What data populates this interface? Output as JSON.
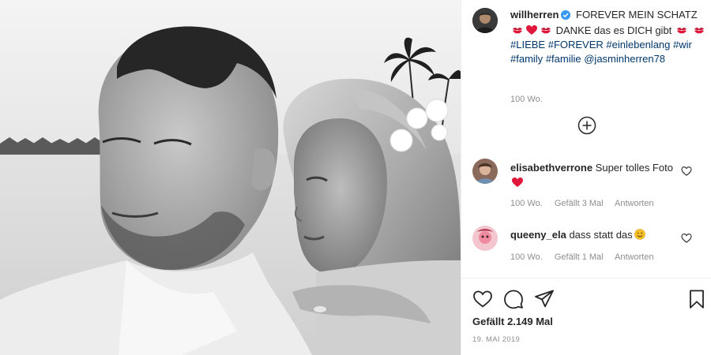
{
  "post": {
    "author": "willherren",
    "caption_parts": {
      "t1": "FOREVER MEIN SCHATZ",
      "t2": "DANKE das es DICH gibt",
      "tag_liebe": "#LIEBE",
      "tag_forever": "#FOREVER",
      "tag_einlebenlang": "#einlebenlang",
      "tag_wir": "#wir",
      "tag_family": "#family",
      "tag_familie": "#familie",
      "mention": "@jasminherren78"
    },
    "time": "100 Wo."
  },
  "comments": [
    {
      "user": "elisabethverrone",
      "text": "Super tolles Foto",
      "time": "100 Wo.",
      "likes": "Gefällt 3 Mal",
      "reply": "Antworten"
    },
    {
      "user": "queeny_ela",
      "text": "dass statt das",
      "time": "100 Wo.",
      "likes": "Gefällt 1 Mal",
      "reply": "Antworten"
    }
  ],
  "footer": {
    "likes": "Gefällt 2.149 Mal",
    "date": "19. MAI 2019"
  },
  "icons": {
    "verified": "verified-badge-icon",
    "load_more": "plus-circle-icon",
    "like": "heart-icon",
    "comment": "comment-icon",
    "share": "paper-plane-icon",
    "save": "bookmark-icon"
  },
  "colors": {
    "verified": "#3897f0",
    "hashtag": "#00376b",
    "meta": "#8e8e8e",
    "text": "#262626",
    "heart_red": "#e0173a"
  }
}
